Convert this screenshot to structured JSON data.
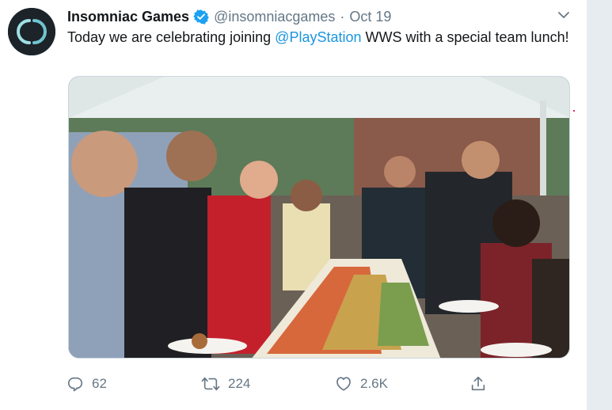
{
  "tweet": {
    "display_name": "Insomniac Games",
    "handle": "@insomniacgames",
    "separator": "·",
    "date": "Oct 19",
    "text_before": "Today we are celebrating joining ",
    "mention": "@PlayStation",
    "text_after": " WWS with a special team lunch!",
    "media_alt": "Team members serving themselves at a long outdoor buffet table under a white tent"
  },
  "actions": {
    "reply_count": "62",
    "retweet_count": "224",
    "like_count": "2.6K"
  },
  "icons": {
    "avatar": "insomniac-logo",
    "verified": "verified-badge-icon",
    "caret": "chevron-down-icon",
    "reply": "reply-icon",
    "retweet": "retweet-icon",
    "like": "heart-icon",
    "share": "share-icon"
  },
  "colors": {
    "link": "#1b95e0",
    "secondary_text": "#657786",
    "verified": "#1da1f2",
    "avatar_bg": "#1c2329"
  }
}
